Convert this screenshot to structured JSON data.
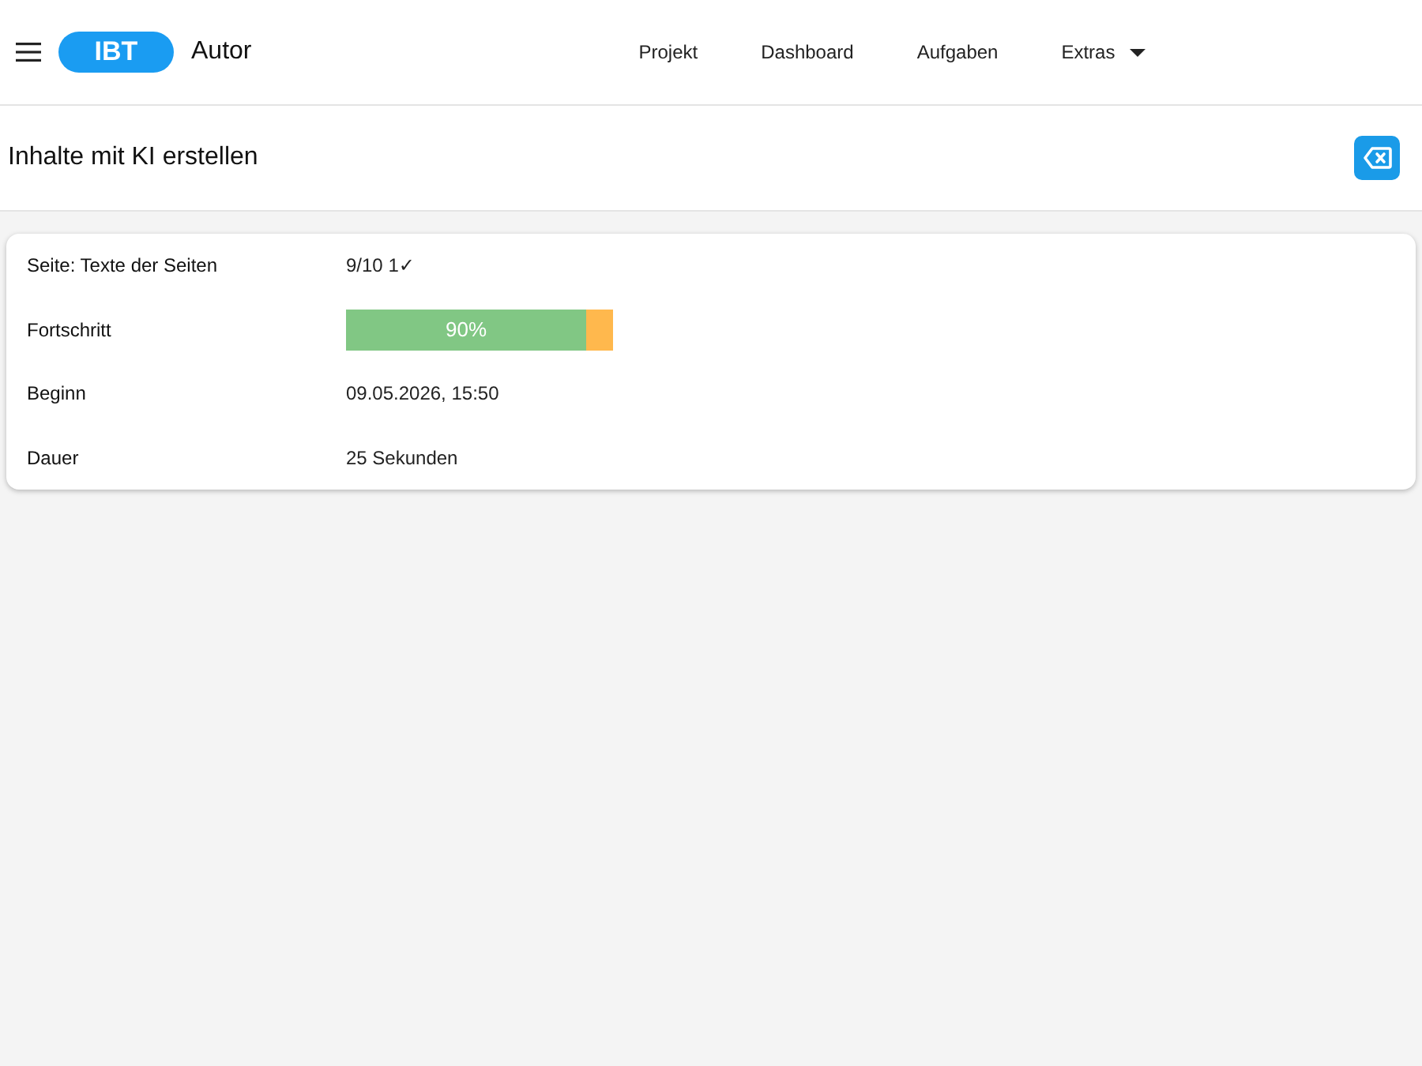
{
  "header": {
    "logo": "IBT",
    "app_title": "Autor",
    "nav": [
      {
        "label": "Projekt",
        "kind": "link"
      },
      {
        "label": "Dashboard",
        "kind": "link"
      },
      {
        "label": "Aufgaben",
        "kind": "link"
      },
      {
        "label": "Extras",
        "kind": "dropdown"
      }
    ]
  },
  "page": {
    "title": "Inhalte mit KI erstellen"
  },
  "details": [
    {
      "label": "Seite: Texte der Seiten",
      "kind": "text",
      "value": "9/10 1✓"
    },
    {
      "label": "Fortschritt",
      "kind": "progress",
      "level": 0.9,
      "reading": "90%"
    },
    {
      "label": "Beginn",
      "kind": "text",
      "value": "09.05.2026, 15:50"
    },
    {
      "label": "Dauer",
      "kind": "text",
      "value": "25 Sekunden"
    }
  ]
}
